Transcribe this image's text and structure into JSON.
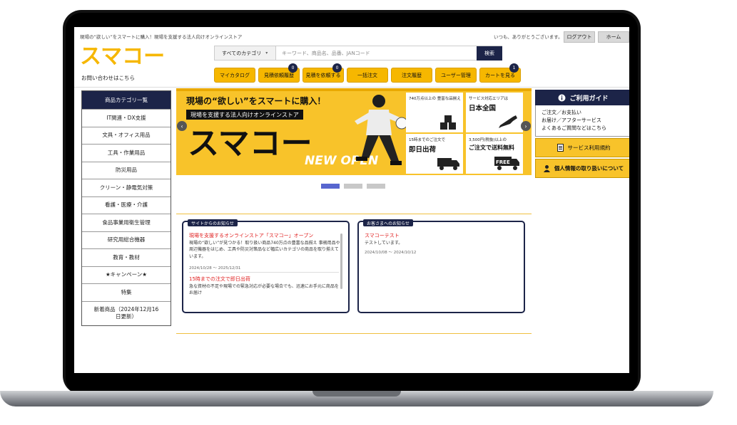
{
  "header": {
    "tagline": "現場の“欲しい”をスマートに購入！現場を支援する法人向けオンラインストア",
    "greeting": "いつも、ありがとうございます。",
    "logout": "ログアウト",
    "home": "ホーム",
    "logo": "スマコー",
    "contact": "お問い合わせはこちら"
  },
  "search": {
    "category": "すべてのカテゴリ",
    "placeholder": "キーワード、商品名、品番、JANコード",
    "button": "検索"
  },
  "nav": [
    {
      "label": "マイカタログ",
      "badge": ""
    },
    {
      "label": "見積依頼履歴",
      "badge": "0"
    },
    {
      "label": "見積を依頼する",
      "badge": "0"
    },
    {
      "label": "一括注文",
      "badge": ""
    },
    {
      "label": "注文履歴",
      "badge": ""
    },
    {
      "label": "ユーザー管理",
      "badge": ""
    },
    {
      "label": "カートを見る",
      "badge": "1"
    }
  ],
  "sidebar": {
    "title": "商品カテゴリ一覧",
    "items": [
      "IT関連・DX支援",
      "文具・オフィス用品",
      "工具・作業用品",
      "防災用品",
      "クリーン・静電気対策",
      "看護・医療・介護",
      "食品事業用衛生管理",
      "研究用総合機器",
      "教育・教材",
      "★キャンペーン★",
      "特集",
      "新着商品（2024年12月16日更新）"
    ]
  },
  "banner": {
    "title1": "現場の“欲しい”をスマートに購入！",
    "title2": "現場を支援する法人向けオンラインストア",
    "big": "スマコー",
    "new_open": "NEW OPEN",
    "cards": [
      {
        "top": "740万点以上の 豊富な品揃え",
        "main": ""
      },
      {
        "top": "サービス対応エリアは",
        "main": "日本全国"
      },
      {
        "top": "15時までのご注文で",
        "main": "即日出荷"
      },
      {
        "top": "3,500円(税抜)以上の",
        "main": "ご注文で送料無料"
      }
    ],
    "free_label": "FREE"
  },
  "news_site": {
    "label": "サイトからのお知らせ",
    "items": [
      {
        "title": "現場を支援するオンラインストア「スマコー」オープン",
        "body": "現場の“欲しい”が見つかる！取り扱い商品740万点の豊富な品揃え 事務用品や周辺機器をはじめ、工具や防災対策品など幅広いカテゴリの商品を取り揃えています。",
        "date": "2024/10/28 〜 2025/12/31"
      },
      {
        "title": "15時までの注文で即日出荷",
        "body": "急な資材の不足や現場での緊急対応が必要な場合でも、迅速にお手元に商品をお届け",
        "date": ""
      }
    ]
  },
  "news_customer": {
    "label": "お客さまへのお知らせ",
    "items": [
      {
        "title": "スマコーテスト",
        "body": "テストしています。",
        "date": "2024/10/08 〜 2024/10/12"
      }
    ]
  },
  "guide": {
    "title": "ご利用ガイド",
    "lines": [
      "ご注文／お支払い",
      "お届け／アフターサービス",
      "よくあるご質問などはこちら"
    ],
    "terms": "サービス利用規約",
    "privacy": "個人情報の取り扱いについて"
  }
}
